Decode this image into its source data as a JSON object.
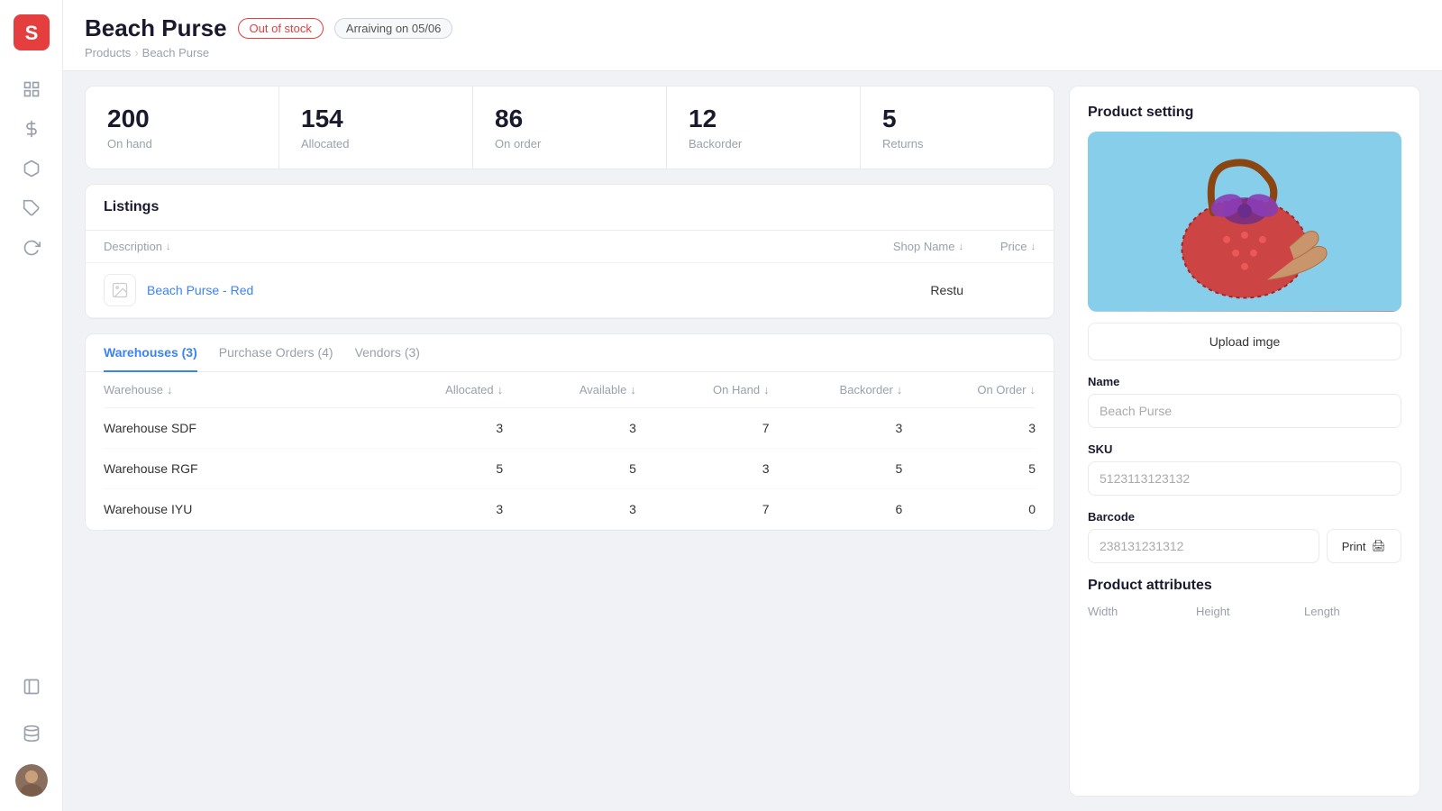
{
  "app": {
    "logo_label": "S"
  },
  "sidebar": {
    "icons": [
      {
        "name": "grid-icon",
        "symbol": "⊞"
      },
      {
        "name": "dollar-icon",
        "symbol": "$"
      },
      {
        "name": "box-icon",
        "symbol": "◫"
      },
      {
        "name": "tag-icon",
        "symbol": "⬡"
      },
      {
        "name": "refresh-icon",
        "symbol": "↻"
      },
      {
        "name": "sidebar-bottom-icon",
        "symbol": "▤"
      },
      {
        "name": "database-icon",
        "symbol": "⬛"
      }
    ]
  },
  "header": {
    "title": "Beach Purse",
    "badge_stock": "Out of stock",
    "badge_arriving": "Arraiving on 05/06",
    "breadcrumb": [
      "Products",
      "Beach Purse"
    ]
  },
  "stats": [
    {
      "value": "200",
      "label": "On hand"
    },
    {
      "value": "154",
      "label": "Allocated"
    },
    {
      "value": "86",
      "label": "On order"
    },
    {
      "value": "12",
      "label": "Backorder"
    },
    {
      "value": "5",
      "label": "Returns"
    }
  ],
  "listings": {
    "title": "Listings",
    "columns": {
      "description": "Description",
      "shop_name": "Shop Name",
      "price": "Price"
    },
    "rows": [
      {
        "name": "Beach Purse - Red",
        "shop": "Restu",
        "price": ""
      }
    ]
  },
  "warehouses_tab": {
    "label": "Warehouses (3)",
    "count": 3
  },
  "purchase_orders_tab": {
    "label": "Purchase Orders (4)"
  },
  "vendors_tab": {
    "label": "Vendors (3)"
  },
  "warehouse_table": {
    "columns": [
      "Warehouse",
      "Allocated",
      "Available",
      "On Hand",
      "Backorder",
      "On Order"
    ],
    "rows": [
      {
        "name": "Warehouse SDF",
        "allocated": 3,
        "available": 3,
        "on_hand": 7,
        "backorder": 3,
        "on_order": 3
      },
      {
        "name": "Warehouse RGF",
        "allocated": 5,
        "available": 5,
        "on_hand": 3,
        "backorder": 5,
        "on_order": 5
      },
      {
        "name": "Warehouse IYU",
        "allocated": 3,
        "available": 3,
        "on_hand": 7,
        "backorder": 6,
        "on_order": 0
      }
    ]
  },
  "product_setting": {
    "title": "Product setting",
    "upload_label": "Upload imge",
    "name_label": "Name",
    "name_value": "Beach Purse",
    "sku_label": "SKU",
    "sku_value": "5123113123132",
    "barcode_label": "Barcode",
    "barcode_value": "238131231312",
    "print_label": "Print",
    "attributes_title": "Product attributes",
    "attr_labels": [
      "Width",
      "Height",
      "Length"
    ]
  }
}
